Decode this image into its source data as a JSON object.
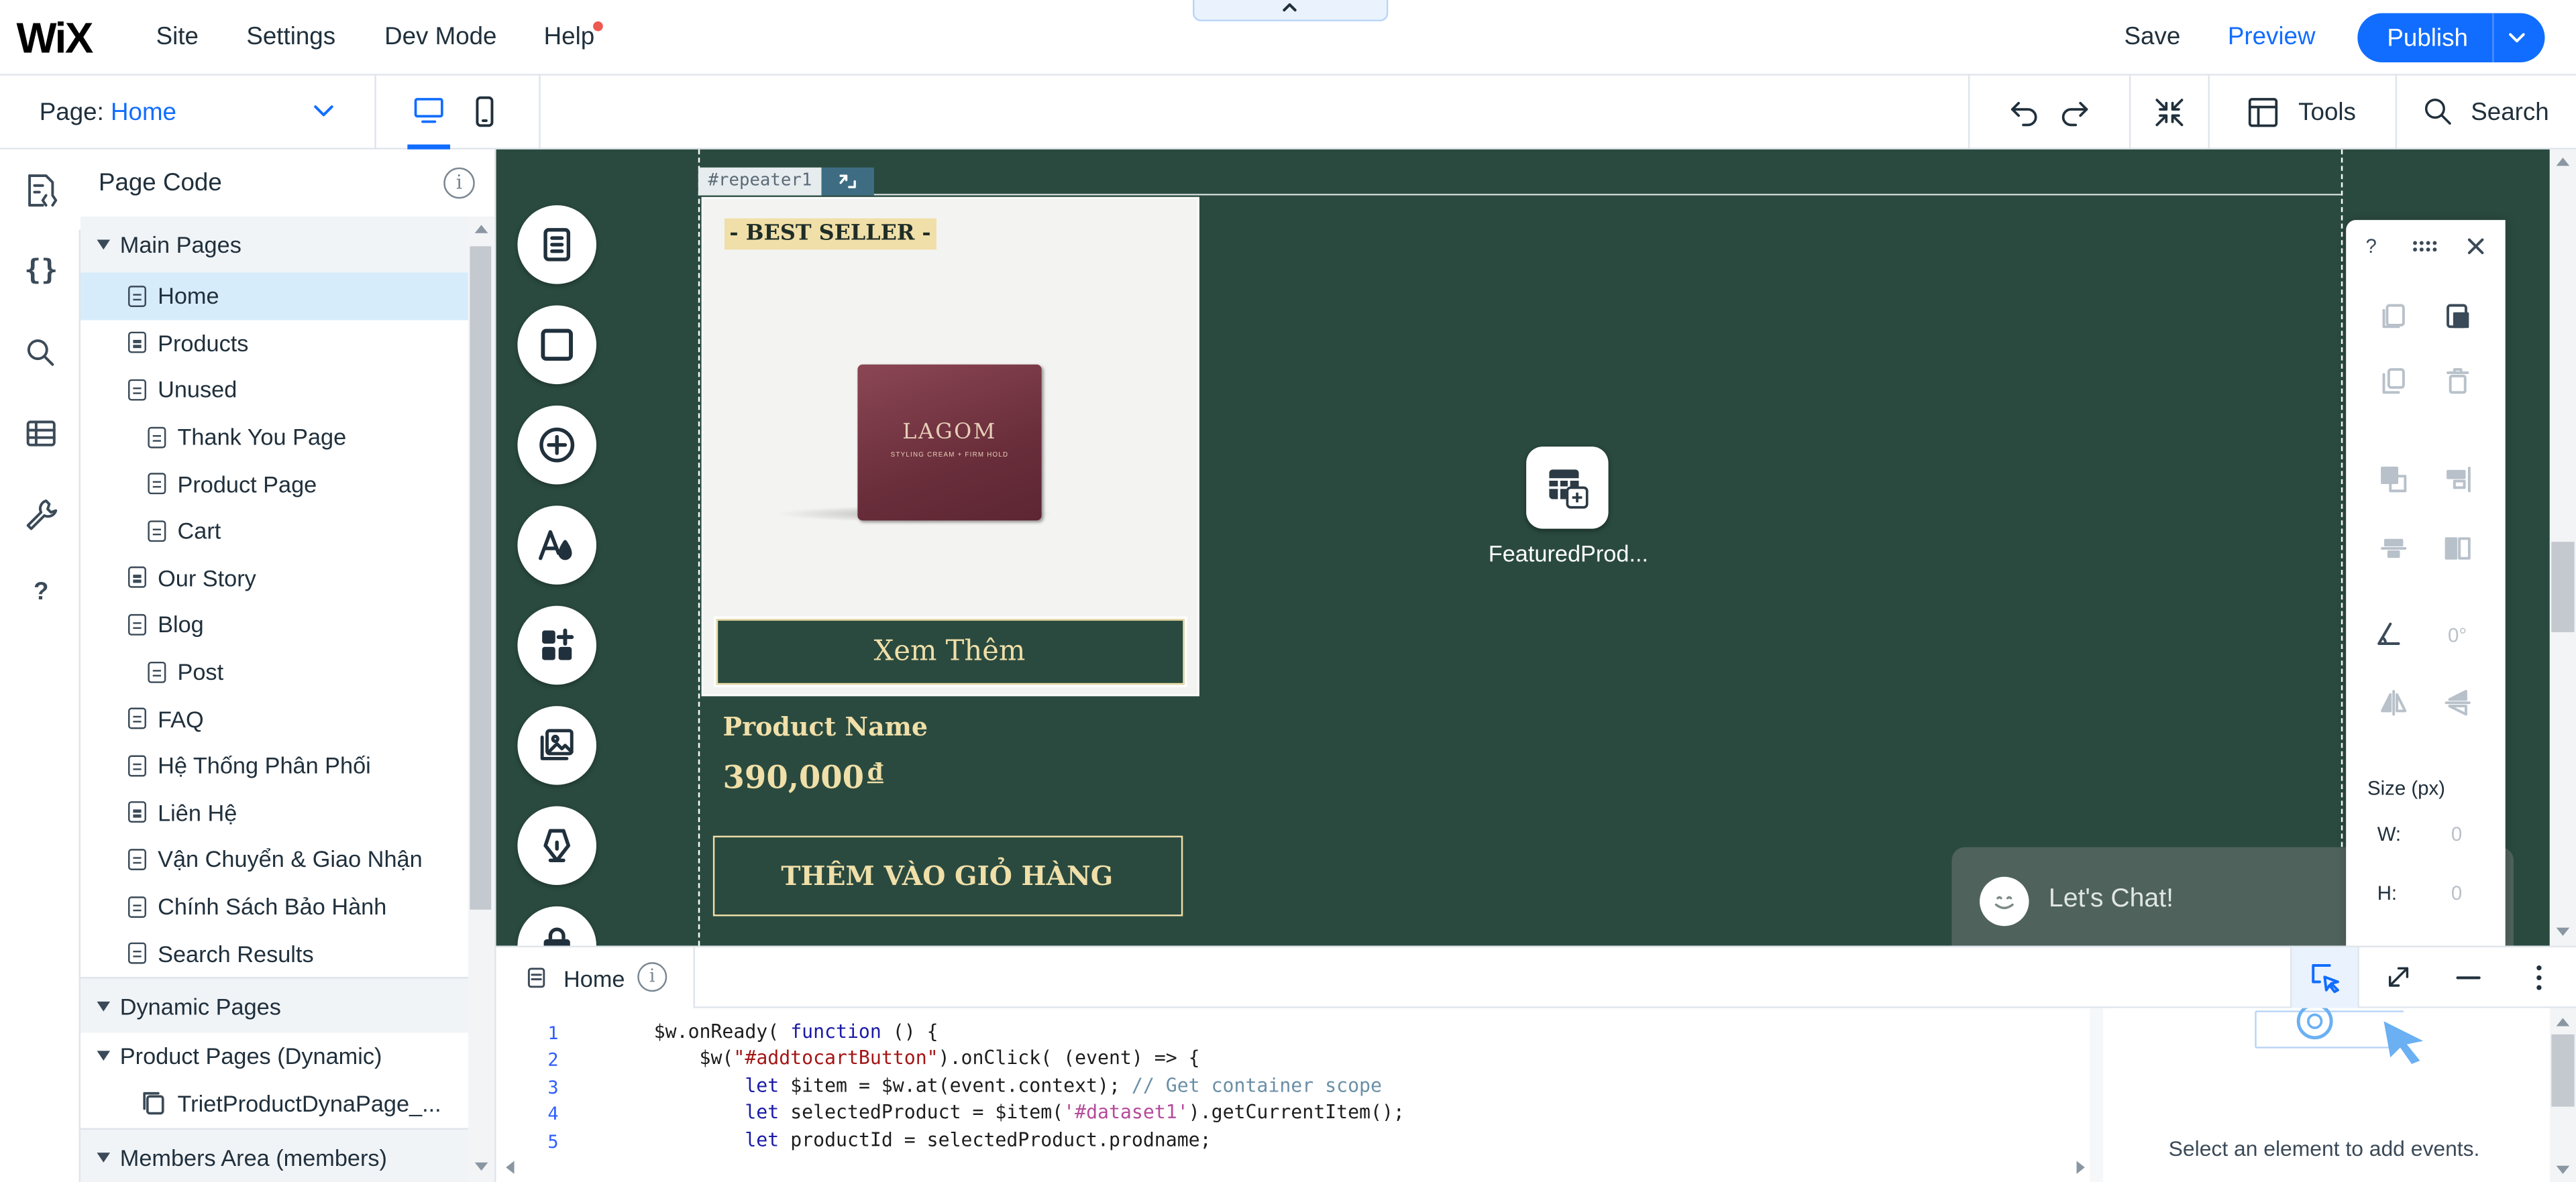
{
  "topbar": {
    "logo": "WiX",
    "menu": [
      "Site",
      "Settings",
      "Dev Mode",
      "Help"
    ],
    "save": "Save",
    "preview": "Preview",
    "publish": "Publish"
  },
  "secondbar": {
    "page_label": "Page:",
    "page_value": "Home",
    "tools": "Tools",
    "search": "Search"
  },
  "leftpanel": {
    "title": "Page Code",
    "main_pages_title": "Main Pages",
    "main_pages": [
      {
        "label": "Home",
        "level": 1,
        "selected": true
      },
      {
        "label": "Products",
        "level": 1
      },
      {
        "label": "Unused",
        "level": 1
      },
      {
        "label": "Thank You Page",
        "level": 2
      },
      {
        "label": "Product Page",
        "level": 2
      },
      {
        "label": "Cart",
        "level": 2
      },
      {
        "label": "Our Story",
        "level": 1
      },
      {
        "label": "Blog",
        "level": 1
      },
      {
        "label": "Post",
        "level": 2
      },
      {
        "label": "FAQ",
        "level": 1
      },
      {
        "label": "Hệ Thống Phân Phối",
        "level": 1
      },
      {
        "label": "Liên Hệ",
        "level": 1
      },
      {
        "label": "Vận Chuyển & Giao Nhận",
        "level": 1
      },
      {
        "label": "Chính Sách Bảo Hành",
        "level": 1
      },
      {
        "label": "Search Results",
        "level": 1
      }
    ],
    "dynamic_pages_title": "Dynamic Pages",
    "product_pages_dynamic": "Product Pages (Dynamic)",
    "triet_item": "TrietProductDynaPage_...",
    "members_area": "Members Area (members)"
  },
  "canvas": {
    "repeater_tag": "#repeater1",
    "best_seller": "- BEST SELLER -",
    "product_box_brand": "LAGOM",
    "product_box_sub": "STYLING CREAM + FIRM HOLD",
    "xem_them": "Xem Thêm",
    "product_name": "Product Name",
    "price": "390,000",
    "currency": "đ",
    "add_to_cart": "THÊM VÀO GIỎ HÀNG",
    "dataset_label": "FeaturedProd...",
    "lets_chat": "Let's Chat!"
  },
  "floatpanel": {
    "help": "?",
    "rotation": "0°",
    "size_title": "Size (px)",
    "w_label": "W:",
    "w_value": "0",
    "h_label": "H:",
    "h_value": "0"
  },
  "codepanel": {
    "tab": "Home",
    "lines": [
      "1",
      "2",
      "3",
      "4",
      "5"
    ],
    "select_hint": "Select an element to add events."
  },
  "colors": {
    "accent": "#116dff",
    "canvas_bg": "#2a4a3f",
    "gold": "#f0dfa8",
    "selected_row": "#d7ecfb"
  }
}
